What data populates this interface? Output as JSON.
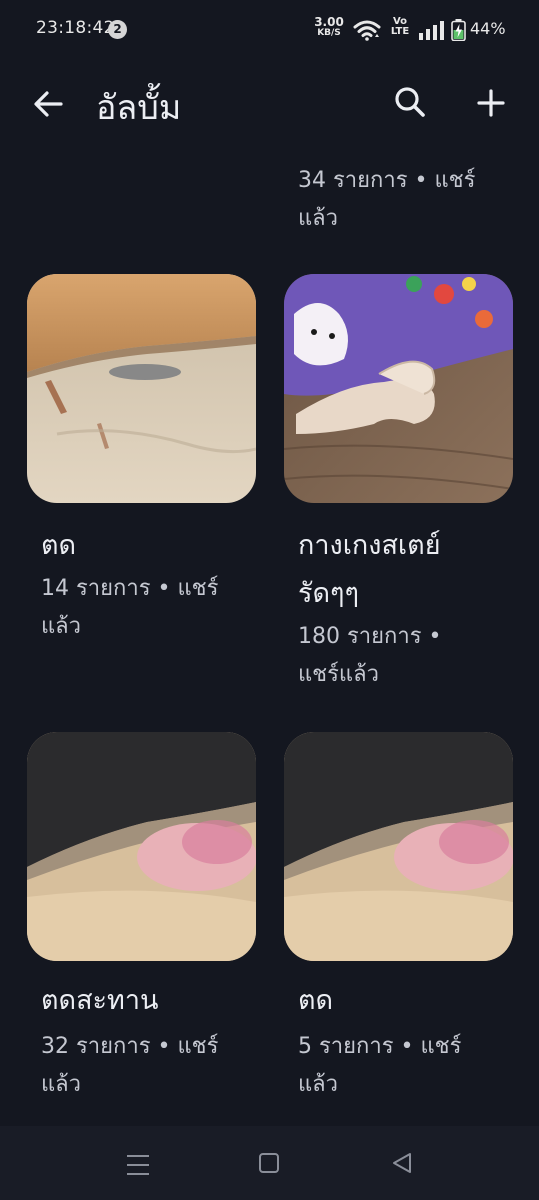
{
  "status_bar": {
    "time": "23:18:42",
    "notification_count": "2",
    "net_speed_value": "3.00",
    "net_speed_unit": "KB/S",
    "volte_top": "Vo",
    "volte_bottom": "LTE",
    "battery_percent": "44%"
  },
  "header": {
    "title": "อัลบั้ม"
  },
  "albums": [
    {
      "meta_line1": "34 รายการ • แชร์",
      "meta_line2": "แล้ว"
    },
    {
      "name": "ตด",
      "meta_line1": "14 รายการ • แชร์",
      "meta_line2": "แล้ว",
      "thumbnail": "sand-under-fabric-photo"
    },
    {
      "name_line1": "กางเกงสเตย์",
      "name_line2": "รัดๆๆ",
      "meta_line1": "180 รายการ •",
      "meta_line2": "แชร์แล้ว",
      "thumbnail": "toy-on-wood-photo"
    },
    {
      "name": "ตดสะทาน",
      "meta_line1": "32 รายการ • แชร์",
      "meta_line2": "แล้ว",
      "thumbnail": "pink-object-under-cloth-photo"
    },
    {
      "name": "ตด",
      "meta_line1": "5 รายการ • แชร์",
      "meta_line2": "แล้ว",
      "thumbnail": "pink-object-under-cloth-photo"
    }
  ],
  "colors": {
    "background": "#141720",
    "nav_background": "#191c26",
    "text_primary": "#eceef3",
    "text_secondary": "#c5c8d1",
    "battery_charging": "#5ec26a"
  },
  "icons": {
    "back": "arrow-left-icon",
    "search": "search-icon",
    "add": "plus-icon",
    "nav_recents": "menu-lines-icon",
    "nav_home": "square-icon",
    "nav_back": "triangle-back-icon"
  }
}
